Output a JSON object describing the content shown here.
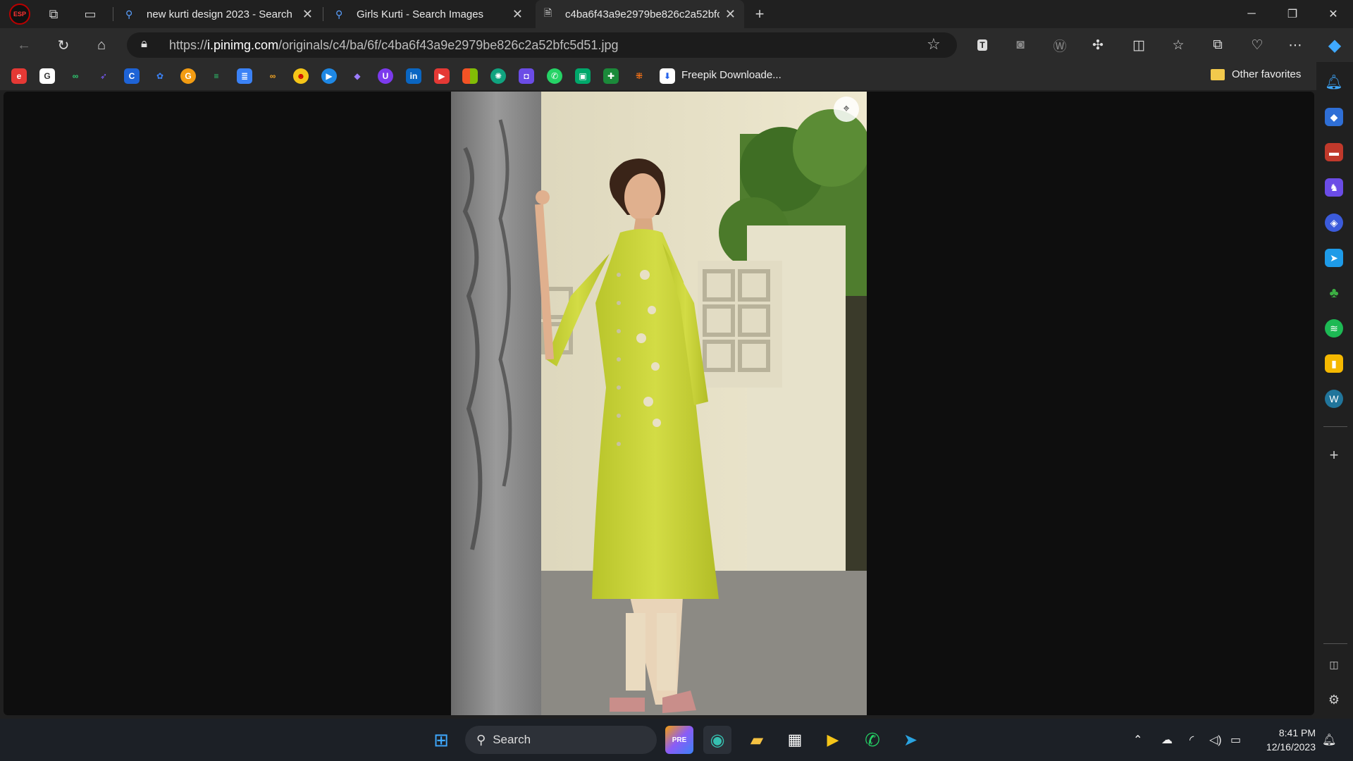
{
  "tabs": [
    {
      "title": "new kurti design 2023 - Search",
      "icon": "search-icon"
    },
    {
      "title": "Girls Kurti - Search Images",
      "icon": "search-icon"
    },
    {
      "title": "c4ba6f43a9e2979be826c2a52bfc5d51.jpg",
      "icon": "document-icon",
      "active": true
    }
  ],
  "address": {
    "scheme": "https://",
    "host": "i.pinimg.com",
    "path": "/originals/c4/ba/6f/c4ba6f43a9e2979be826c2a52bfc5d51.jpg"
  },
  "favorites": {
    "labeled_item": "Freepik Downloade...",
    "other_favorites": "Other favorites"
  },
  "taskbar": {
    "search_label": "Search",
    "time": "8:41 PM",
    "date": "12/16/2023"
  },
  "colors": {
    "accent": "#0a84ff",
    "kurti": "#c8d43a"
  }
}
